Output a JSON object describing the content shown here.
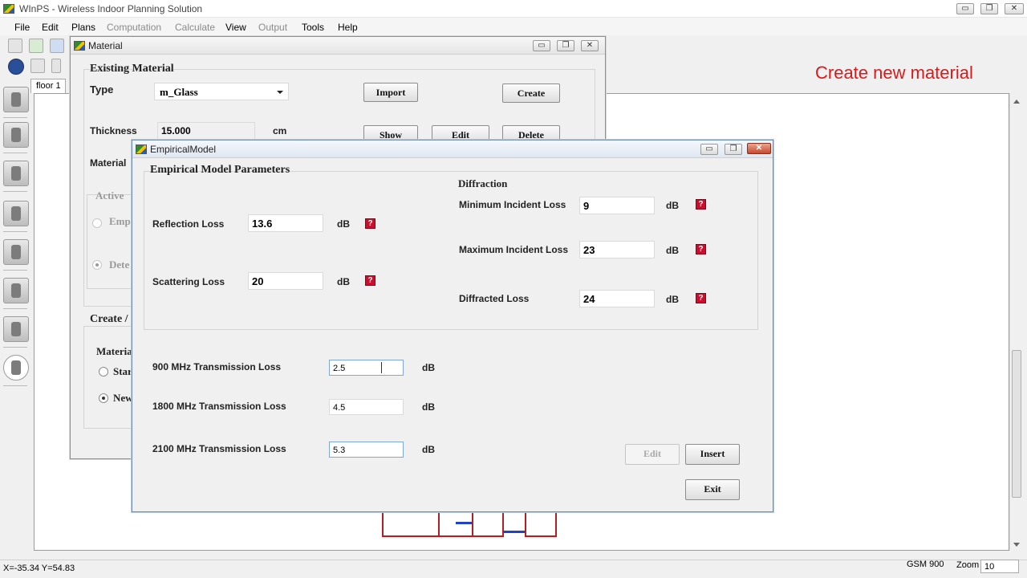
{
  "app": {
    "title": "WInPS - Wireless Indoor Planning Solution",
    "window_controls": {
      "minimize": "▭",
      "restore": "❐",
      "close": "✕"
    }
  },
  "menu": {
    "items": [
      {
        "label": "File",
        "enabled": true
      },
      {
        "label": "Edit",
        "enabled": true
      },
      {
        "label": "Plans",
        "enabled": true
      },
      {
        "label": "Computation",
        "enabled": false
      },
      {
        "label": "Calculate",
        "enabled": false
      },
      {
        "label": "View",
        "enabled": true
      },
      {
        "label": "Output",
        "enabled": false
      },
      {
        "label": "Tools",
        "enabled": true
      },
      {
        "label": "Help",
        "enabled": true
      }
    ]
  },
  "tab": {
    "label": "floor 1"
  },
  "annotation": {
    "text": "Create new material",
    "color": "#d91a1a"
  },
  "status": {
    "coords": "X=-35.34  Y=54.83",
    "band": "GSM 900",
    "zoom_label": "Zoom",
    "zoom_value": "10"
  },
  "material_dialog": {
    "title": "Material",
    "existing_group": "Existing Material",
    "type_label": "Type",
    "type_value": "m_Glass",
    "import_btn": "Import",
    "create_btn": "Create",
    "thickness_label": "Thickness",
    "thickness_value": "15.000",
    "thickness_unit": "cm",
    "show_btn": "Show",
    "edit_btn": "Edit",
    "delete_btn": "Delete",
    "material_label": "Material",
    "active_label": "Active",
    "radio_emp": "Emp",
    "radio_dete": "Dete",
    "create_group": "Create /",
    "materia_label": "Materia",
    "radio_star": "Star",
    "radio_new": "New"
  },
  "empirical_dialog": {
    "title": "EmpiricalModel",
    "params_group": "Empirical Model Parameters",
    "reflection_label": "Reflection Loss",
    "reflection_value": "13.6",
    "scattering_label": "Scattering Loss",
    "scattering_value": "20",
    "diffraction_title": "Diffraction",
    "min_incident_label": "Minimum Incident Loss",
    "min_incident_value": "9",
    "max_incident_label": "Maximum Incident Loss",
    "max_incident_value": "23",
    "diffracted_label": "Diffracted Loss",
    "diffracted_value": "24",
    "unit_db": "dB",
    "help_glyph": "?",
    "tx900_label": "900 MHz Transmission Loss",
    "tx900_value": "2.5",
    "tx1800_label": "1800 MHz Transmission Loss",
    "tx1800_value": "4.5",
    "tx2100_label": "2100 MHz Transmission Loss",
    "tx2100_value": "5.3",
    "edit_btn": "Edit",
    "insert_btn": "Insert",
    "exit_btn": "Exit"
  },
  "colors": {
    "wall": "#b41e1e",
    "door": "#2241c8",
    "help_icon": "#c8102e"
  }
}
